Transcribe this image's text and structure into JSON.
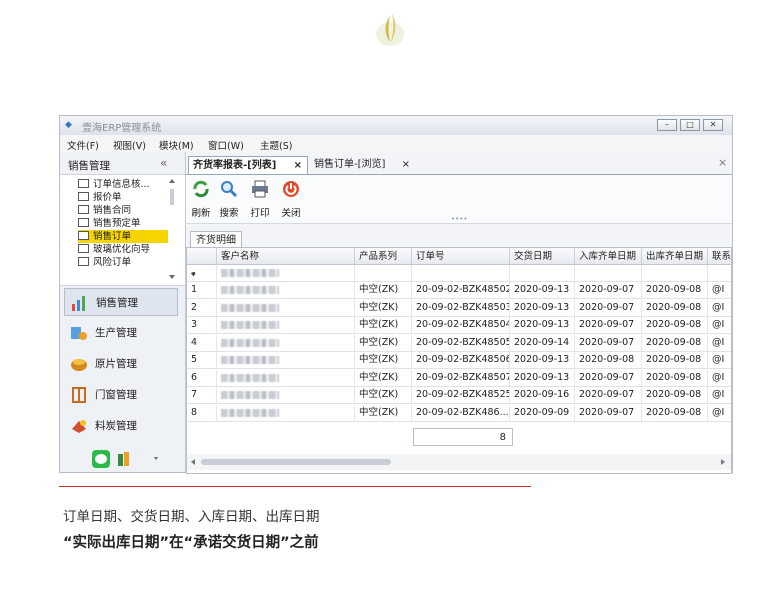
{
  "window": {
    "title": "壹海ERP管理系统",
    "menu": [
      "文件(F)",
      "视图(V)",
      "模块(M)",
      "窗口(W)",
      "主题(S)"
    ]
  },
  "left_panel": {
    "header": "销售管理",
    "collapse_glyph": "«",
    "tree_items": [
      "订单信息核...",
      "报价单",
      "销售合同",
      "销售预定单",
      "销售订单",
      "玻璃优化向导",
      "风险订单"
    ],
    "selected_tree_item": "销售订单",
    "nav_items": [
      "销售管理",
      "生产管理",
      "原片管理",
      "门窗管理",
      "料炭管理"
    ]
  },
  "tabs": [
    {
      "label": "齐货率报表-[列表]",
      "close": "×"
    },
    {
      "label": "销售订单-[浏览]",
      "close": "×"
    }
  ],
  "tabs_close_all": "×",
  "toolbar": [
    "刷新",
    "搜索",
    "打印",
    "关闭"
  ],
  "subtab": "齐货明细",
  "grid": {
    "columns": [
      "客户名称",
      "产品系列",
      "订单号",
      "交货日期",
      "入库齐单日期",
      "出库齐单日期",
      "联系"
    ],
    "filter_glyph": "ᵩ",
    "rows": [
      {
        "n": "1",
        "series": "中空(ZK)",
        "order": "20-09-02-BZK48502",
        "delivery": "2020-09-13",
        "in": "2020-09-07",
        "out": "2020-09-08",
        "contact": "@I"
      },
      {
        "n": "2",
        "series": "中空(ZK)",
        "order": "20-09-02-BZK48503",
        "delivery": "2020-09-13",
        "in": "2020-09-07",
        "out": "2020-09-08",
        "contact": "@I"
      },
      {
        "n": "3",
        "series": "中空(ZK)",
        "order": "20-09-02-BZK48504",
        "delivery": "2020-09-13",
        "in": "2020-09-07",
        "out": "2020-09-08",
        "contact": "@I"
      },
      {
        "n": "4",
        "series": "中空(ZK)",
        "order": "20-09-02-BZK48505",
        "delivery": "2020-09-14",
        "in": "2020-09-07",
        "out": "2020-09-08",
        "contact": "@I"
      },
      {
        "n": "5",
        "series": "中空(ZK)",
        "order": "20-09-02-BZK48506",
        "delivery": "2020-09-13",
        "in": "2020-09-08",
        "out": "2020-09-08",
        "contact": "@I"
      },
      {
        "n": "6",
        "series": "中空(ZK)",
        "order": "20-09-02-BZK48507",
        "delivery": "2020-09-13",
        "in": "2020-09-07",
        "out": "2020-09-08",
        "contact": "@I"
      },
      {
        "n": "7",
        "series": "中空(ZK)",
        "order": "20-09-02-BZK48525",
        "delivery": "2020-09-16",
        "in": "2020-09-07",
        "out": "2020-09-08",
        "contact": "@I"
      },
      {
        "n": "8",
        "series": "中空(ZK)",
        "order": "20-09-02-BZK486...",
        "delivery": "2020-09-09",
        "in": "2020-09-07",
        "out": "2020-09-08",
        "contact": "@I"
      }
    ],
    "summary_count": "8"
  },
  "caption": {
    "line1": "订单日期、交货日期、入库日期、出库日期",
    "line2": "“实际出库日期”在“承诺交货日期”之前"
  },
  "colors": {
    "accent_red": "#c0392b",
    "selected_yellow": "#f5d400"
  }
}
